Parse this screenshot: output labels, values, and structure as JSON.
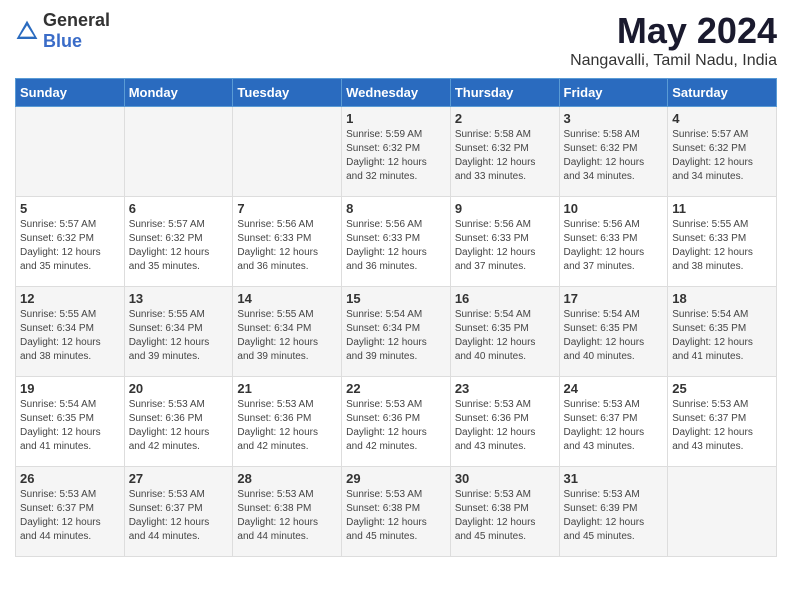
{
  "logo": {
    "text_general": "General",
    "text_blue": "Blue"
  },
  "title": "May 2024",
  "subtitle": "Nangavalli, Tamil Nadu, India",
  "headers": [
    "Sunday",
    "Monday",
    "Tuesday",
    "Wednesday",
    "Thursday",
    "Friday",
    "Saturday"
  ],
  "weeks": [
    [
      {
        "day": "",
        "info": ""
      },
      {
        "day": "",
        "info": ""
      },
      {
        "day": "",
        "info": ""
      },
      {
        "day": "1",
        "info": "Sunrise: 5:59 AM\nSunset: 6:32 PM\nDaylight: 12 hours and 32 minutes."
      },
      {
        "day": "2",
        "info": "Sunrise: 5:58 AM\nSunset: 6:32 PM\nDaylight: 12 hours and 33 minutes."
      },
      {
        "day": "3",
        "info": "Sunrise: 5:58 AM\nSunset: 6:32 PM\nDaylight: 12 hours and 34 minutes."
      },
      {
        "day": "4",
        "info": "Sunrise: 5:57 AM\nSunset: 6:32 PM\nDaylight: 12 hours and 34 minutes."
      }
    ],
    [
      {
        "day": "5",
        "info": "Sunrise: 5:57 AM\nSunset: 6:32 PM\nDaylight: 12 hours and 35 minutes."
      },
      {
        "day": "6",
        "info": "Sunrise: 5:57 AM\nSunset: 6:32 PM\nDaylight: 12 hours and 35 minutes."
      },
      {
        "day": "7",
        "info": "Sunrise: 5:56 AM\nSunset: 6:33 PM\nDaylight: 12 hours and 36 minutes."
      },
      {
        "day": "8",
        "info": "Sunrise: 5:56 AM\nSunset: 6:33 PM\nDaylight: 12 hours and 36 minutes."
      },
      {
        "day": "9",
        "info": "Sunrise: 5:56 AM\nSunset: 6:33 PM\nDaylight: 12 hours and 37 minutes."
      },
      {
        "day": "10",
        "info": "Sunrise: 5:56 AM\nSunset: 6:33 PM\nDaylight: 12 hours and 37 minutes."
      },
      {
        "day": "11",
        "info": "Sunrise: 5:55 AM\nSunset: 6:33 PM\nDaylight: 12 hours and 38 minutes."
      }
    ],
    [
      {
        "day": "12",
        "info": "Sunrise: 5:55 AM\nSunset: 6:34 PM\nDaylight: 12 hours and 38 minutes."
      },
      {
        "day": "13",
        "info": "Sunrise: 5:55 AM\nSunset: 6:34 PM\nDaylight: 12 hours and 39 minutes."
      },
      {
        "day": "14",
        "info": "Sunrise: 5:55 AM\nSunset: 6:34 PM\nDaylight: 12 hours and 39 minutes."
      },
      {
        "day": "15",
        "info": "Sunrise: 5:54 AM\nSunset: 6:34 PM\nDaylight: 12 hours and 39 minutes."
      },
      {
        "day": "16",
        "info": "Sunrise: 5:54 AM\nSunset: 6:35 PM\nDaylight: 12 hours and 40 minutes."
      },
      {
        "day": "17",
        "info": "Sunrise: 5:54 AM\nSunset: 6:35 PM\nDaylight: 12 hours and 40 minutes."
      },
      {
        "day": "18",
        "info": "Sunrise: 5:54 AM\nSunset: 6:35 PM\nDaylight: 12 hours and 41 minutes."
      }
    ],
    [
      {
        "day": "19",
        "info": "Sunrise: 5:54 AM\nSunset: 6:35 PM\nDaylight: 12 hours and 41 minutes."
      },
      {
        "day": "20",
        "info": "Sunrise: 5:53 AM\nSunset: 6:36 PM\nDaylight: 12 hours and 42 minutes."
      },
      {
        "day": "21",
        "info": "Sunrise: 5:53 AM\nSunset: 6:36 PM\nDaylight: 12 hours and 42 minutes."
      },
      {
        "day": "22",
        "info": "Sunrise: 5:53 AM\nSunset: 6:36 PM\nDaylight: 12 hours and 42 minutes."
      },
      {
        "day": "23",
        "info": "Sunrise: 5:53 AM\nSunset: 6:36 PM\nDaylight: 12 hours and 43 minutes."
      },
      {
        "day": "24",
        "info": "Sunrise: 5:53 AM\nSunset: 6:37 PM\nDaylight: 12 hours and 43 minutes."
      },
      {
        "day": "25",
        "info": "Sunrise: 5:53 AM\nSunset: 6:37 PM\nDaylight: 12 hours and 43 minutes."
      }
    ],
    [
      {
        "day": "26",
        "info": "Sunrise: 5:53 AM\nSunset: 6:37 PM\nDaylight: 12 hours and 44 minutes."
      },
      {
        "day": "27",
        "info": "Sunrise: 5:53 AM\nSunset: 6:37 PM\nDaylight: 12 hours and 44 minutes."
      },
      {
        "day": "28",
        "info": "Sunrise: 5:53 AM\nSunset: 6:38 PM\nDaylight: 12 hours and 44 minutes."
      },
      {
        "day": "29",
        "info": "Sunrise: 5:53 AM\nSunset: 6:38 PM\nDaylight: 12 hours and 45 minutes."
      },
      {
        "day": "30",
        "info": "Sunrise: 5:53 AM\nSunset: 6:38 PM\nDaylight: 12 hours and 45 minutes."
      },
      {
        "day": "31",
        "info": "Sunrise: 5:53 AM\nSunset: 6:39 PM\nDaylight: 12 hours and 45 minutes."
      },
      {
        "day": "",
        "info": ""
      }
    ]
  ]
}
